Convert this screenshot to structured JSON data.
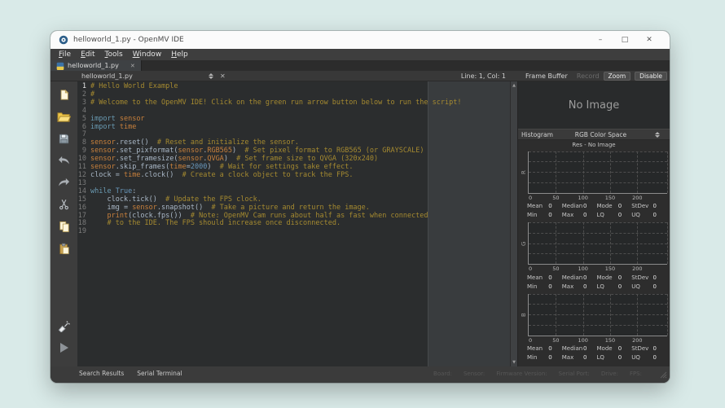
{
  "window": {
    "title": "helloworld_1.py - OpenMV IDE",
    "controls": {
      "minimize": "–",
      "maximize": "□",
      "close": "✕"
    }
  },
  "menu": {
    "items": [
      "File",
      "Edit",
      "Tools",
      "Window",
      "Help"
    ]
  },
  "tab": {
    "label": "helloworld_1.py",
    "close": "✕"
  },
  "doc_toolbar": {
    "filename": "helloworld_1.py",
    "close": "✕",
    "cursor": "Line: 1, Col: 1"
  },
  "frame_buffer": {
    "title": "Frame Buffer",
    "record_label": "Record",
    "zoom_label": "Zoom",
    "disable_label": "Disable",
    "no_image": "No Image"
  },
  "histogram": {
    "title": "Histogram",
    "color_space": "RGB Color Space",
    "res": "Res - No Image"
  },
  "toolbar_icons": [
    "new-file",
    "open-folder",
    "save",
    "undo",
    "redo",
    "cut",
    "copy",
    "paste"
  ],
  "editor": {
    "current_line": 1,
    "lines": [
      {
        "n": 1,
        "segs": [
          [
            "cmt",
            "# Hello World Example"
          ]
        ]
      },
      {
        "n": 2,
        "segs": [
          [
            "cmt",
            "#"
          ]
        ]
      },
      {
        "n": 3,
        "segs": [
          [
            "cmt",
            "# Welcome to the OpenMV IDE! Click on the green run arrow button below to run the script!"
          ]
        ]
      },
      {
        "n": 4,
        "segs": []
      },
      {
        "n": 5,
        "segs": [
          [
            "kw",
            "import"
          ],
          [
            "pl",
            " "
          ],
          [
            "id",
            "sensor"
          ]
        ]
      },
      {
        "n": 6,
        "segs": [
          [
            "kw",
            "import"
          ],
          [
            "pl",
            " "
          ],
          [
            "id",
            "time"
          ]
        ]
      },
      {
        "n": 7,
        "segs": []
      },
      {
        "n": 8,
        "segs": [
          [
            "id",
            "sensor"
          ],
          [
            "pl",
            ".reset()  "
          ],
          [
            "cmt",
            "# Reset and initialize the sensor."
          ]
        ]
      },
      {
        "n": 9,
        "segs": [
          [
            "id",
            "sensor"
          ],
          [
            "pl",
            ".set_pixformat("
          ],
          [
            "id",
            "sensor"
          ],
          [
            "pl",
            "."
          ],
          [
            "id",
            "RGB565"
          ],
          [
            "pl",
            ")  "
          ],
          [
            "cmt",
            "# Set pixel format to RGB565 (or GRAYSCALE)"
          ]
        ]
      },
      {
        "n": 10,
        "segs": [
          [
            "id",
            "sensor"
          ],
          [
            "pl",
            ".set_framesize("
          ],
          [
            "id",
            "sensor"
          ],
          [
            "pl",
            "."
          ],
          [
            "id",
            "QVGA"
          ],
          [
            "pl",
            ")  "
          ],
          [
            "cmt",
            "# Set frame size to QVGA (320x240)"
          ]
        ]
      },
      {
        "n": 11,
        "segs": [
          [
            "id",
            "sensor"
          ],
          [
            "pl",
            ".skip_frames("
          ],
          [
            "id",
            "time"
          ],
          [
            "pl",
            "="
          ],
          [
            "num",
            "2000"
          ],
          [
            "pl",
            ")  "
          ],
          [
            "cmt",
            "# Wait for settings take effect."
          ]
        ]
      },
      {
        "n": 12,
        "segs": [
          [
            "pl",
            "clock = "
          ],
          [
            "id",
            "time"
          ],
          [
            "pl",
            ".clock()  "
          ],
          [
            "cmt",
            "# Create a clock object to track the FPS."
          ]
        ]
      },
      {
        "n": 13,
        "segs": []
      },
      {
        "n": 14,
        "segs": [
          [
            "kw",
            "while"
          ],
          [
            "pl",
            " "
          ],
          [
            "num",
            "True"
          ],
          [
            "pl",
            ":"
          ]
        ]
      },
      {
        "n": 15,
        "segs": [
          [
            "pl",
            "    clock.tick()  "
          ],
          [
            "cmt",
            "# Update the FPS clock."
          ]
        ]
      },
      {
        "n": 16,
        "segs": [
          [
            "pl",
            "    img = "
          ],
          [
            "id",
            "sensor"
          ],
          [
            "pl",
            ".snapshot()  "
          ],
          [
            "cmt",
            "# Take a picture and return the image."
          ]
        ]
      },
      {
        "n": 17,
        "segs": [
          [
            "pl",
            "    "
          ],
          [
            "id",
            "print"
          ],
          [
            "pl",
            "(clock.fps())  "
          ],
          [
            "cmt",
            "# Note: OpenMV Cam runs about half as fast when connected"
          ]
        ]
      },
      {
        "n": 18,
        "segs": [
          [
            "pl",
            "    "
          ],
          [
            "cmt",
            "# to the IDE. The FPS should increase once disconnected."
          ]
        ]
      },
      {
        "n": 19,
        "segs": []
      }
    ]
  },
  "chart_data": [
    {
      "type": "bar",
      "title": "Res - No Image",
      "channel": "R",
      "x_range": [
        0,
        255
      ],
      "x_ticks": [
        0,
        50,
        100,
        150,
        200
      ],
      "values": [],
      "grid": true,
      "stats_rows": [
        [
          [
            "Mean",
            "0"
          ],
          [
            "Median",
            "0"
          ],
          [
            "Mode",
            "0"
          ],
          [
            "StDev",
            "0"
          ]
        ],
        [
          [
            "Min",
            "0"
          ],
          [
            "Max",
            "0"
          ],
          [
            "LQ",
            "0"
          ],
          [
            "UQ",
            "0"
          ]
        ]
      ]
    },
    {
      "type": "bar",
      "title": "Res - No Image",
      "channel": "G",
      "x_range": [
        0,
        255
      ],
      "x_ticks": [
        0,
        50,
        100,
        150,
        200
      ],
      "values": [],
      "grid": true,
      "stats_rows": [
        [
          [
            "Mean",
            "0"
          ],
          [
            "Median",
            "0"
          ],
          [
            "Mode",
            "0"
          ],
          [
            "StDev",
            "0"
          ]
        ],
        [
          [
            "Min",
            "0"
          ],
          [
            "Max",
            "0"
          ],
          [
            "LQ",
            "0"
          ],
          [
            "UQ",
            "0"
          ]
        ]
      ]
    },
    {
      "type": "bar",
      "title": "Res - No Image",
      "channel": "B",
      "x_range": [
        0,
        255
      ],
      "x_ticks": [
        0,
        50,
        100,
        150,
        200
      ],
      "values": [],
      "grid": true,
      "stats_rows": [
        [
          [
            "Mean",
            "0"
          ],
          [
            "Median",
            "0"
          ],
          [
            "Mode",
            "0"
          ],
          [
            "StDev",
            "0"
          ]
        ],
        [
          [
            "Min",
            "0"
          ],
          [
            "Max",
            "0"
          ],
          [
            "LQ",
            "0"
          ],
          [
            "UQ",
            "0"
          ]
        ]
      ]
    }
  ],
  "statusbar": {
    "left": [
      "Search Results",
      "Serial Terminal"
    ],
    "right": [
      "Board:",
      "Sensor:",
      "Firmware Version:",
      "Serial Port:",
      "Drive:",
      "FPS:"
    ]
  },
  "colors": {
    "desktop_bg": "#d9eae8",
    "editor_bg": "#2b2d2e",
    "comment": "#a58a30",
    "keyword": "#6a9bb3",
    "identifier": "#c8803c",
    "constant": "#6897bb",
    "plain": "#a9b7c6"
  }
}
